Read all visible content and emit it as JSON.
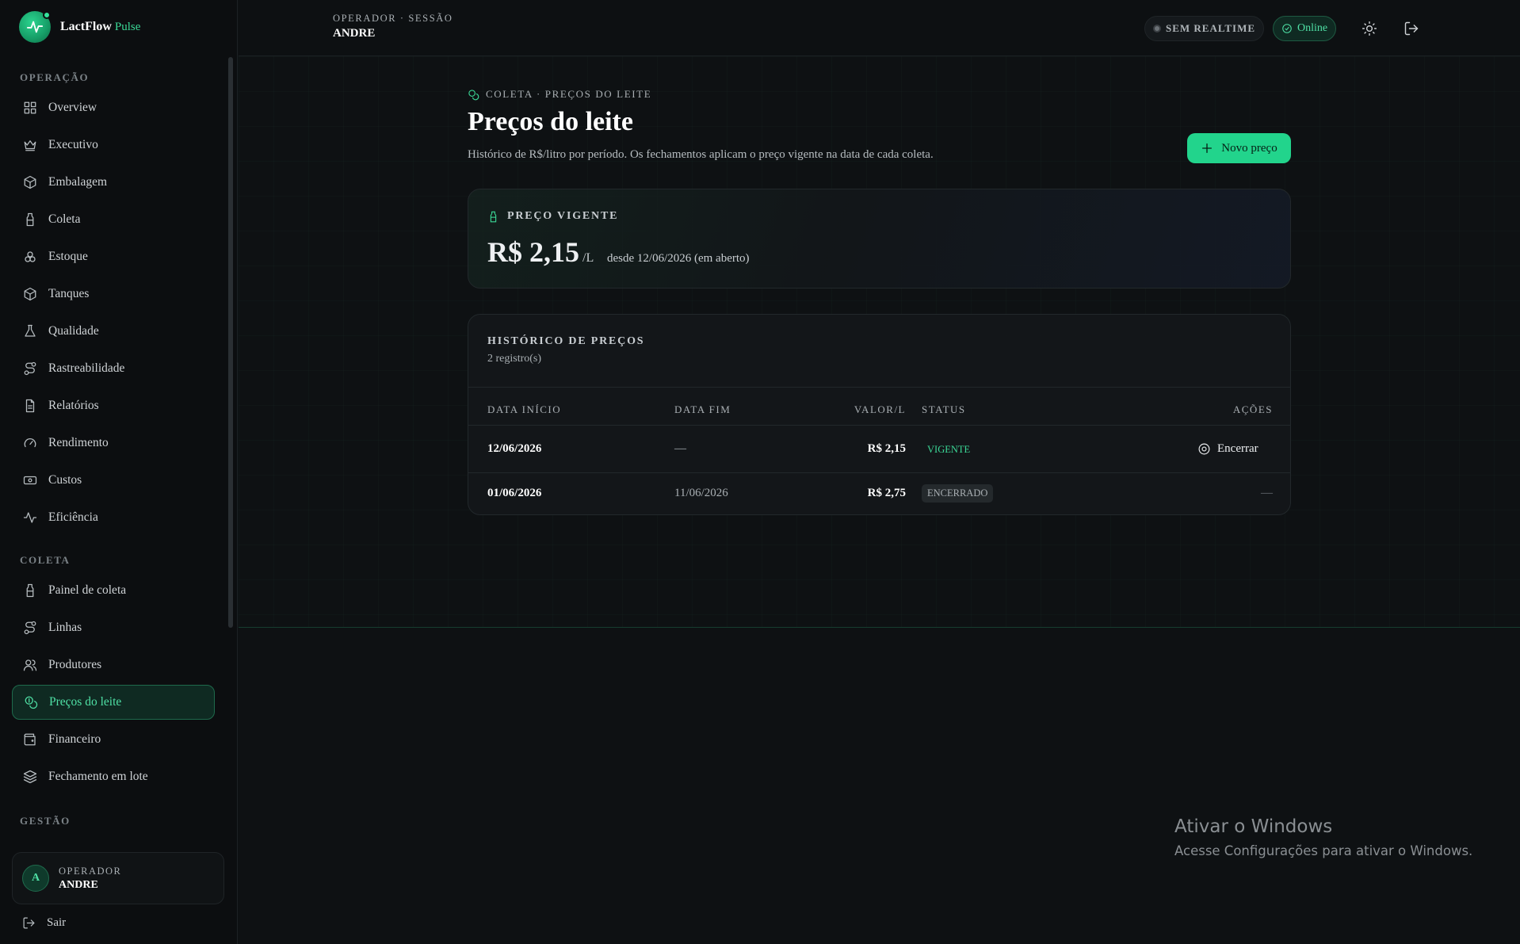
{
  "brand": {
    "name": "LactFlow",
    "sub": "Pulse"
  },
  "sidebar": {
    "sections": [
      {
        "label": "OPERAÇÃO"
      },
      {
        "label": "COLETA"
      },
      {
        "label": "GESTÃO"
      }
    ],
    "operacao": [
      {
        "label": "Overview",
        "icon": "grid-icon"
      },
      {
        "label": "Executivo",
        "icon": "crown-icon"
      },
      {
        "label": "Embalagem",
        "icon": "package-icon"
      },
      {
        "label": "Coleta",
        "icon": "bottle-icon"
      },
      {
        "label": "Estoque",
        "icon": "boxes-icon"
      },
      {
        "label": "Tanques",
        "icon": "box-icon"
      },
      {
        "label": "Qualidade",
        "icon": "flask-icon"
      },
      {
        "label": "Rastreabilidade",
        "icon": "route-icon"
      },
      {
        "label": "Relatórios",
        "icon": "file-icon"
      },
      {
        "label": "Rendimento",
        "icon": "gauge-icon"
      },
      {
        "label": "Custos",
        "icon": "banknote-icon"
      },
      {
        "label": "Eficiência",
        "icon": "activity-icon"
      }
    ],
    "coleta": [
      {
        "label": "Painel de coleta",
        "icon": "bottle-icon"
      },
      {
        "label": "Linhas",
        "icon": "route-icon"
      },
      {
        "label": "Produtores",
        "icon": "users-icon"
      },
      {
        "label": "Preços do leite",
        "icon": "coins-icon",
        "active": true
      },
      {
        "label": "Financeiro",
        "icon": "wallet-icon"
      },
      {
        "label": "Fechamento em lote",
        "icon": "layers-icon"
      }
    ],
    "user": {
      "initial": "A",
      "role": "OPERADOR",
      "name": "ANDRE"
    },
    "logout": "Sair"
  },
  "topbar": {
    "session_label": "OPERADOR · SESSÃO",
    "session_user": "ANDRE",
    "realtime": "SEM REALTIME",
    "online": "Online"
  },
  "main": {
    "breadcrumb": "COLETA · PREÇOS DO LEITE",
    "title": "Preços do leite",
    "description": "Histórico de R$/litro por período. Os fechamentos aplicam o preço vigente na data de cada coleta.",
    "new_button": "Novo preço",
    "current": {
      "label": "PREÇO VIGENTE",
      "value": "R$ 2,15",
      "unit": "/L",
      "since": "desde 12/06/2026 (em aberto)"
    },
    "history": {
      "title": "HISTÓRICO DE PREÇOS",
      "count": "2 registro(s)",
      "columns": [
        "DATA INÍCIO",
        "DATA FIM",
        "VALOR/L",
        "STATUS",
        "AÇÕES"
      ],
      "rows": [
        {
          "start": "12/06/2026",
          "end": "—",
          "value": "R$ 2,15",
          "status": "VIGENTE",
          "action": "Encerrar"
        },
        {
          "start": "01/06/2026",
          "end": "11/06/2026",
          "value": "R$ 2,75",
          "status": "ENCERRADO",
          "action": "—"
        }
      ]
    }
  },
  "windows": {
    "title": "Ativar o Windows",
    "subtitle": "Acesse Configurações para ativar o Windows."
  },
  "colors": {
    "accent": "#22d48c",
    "background": "#0e1113"
  }
}
